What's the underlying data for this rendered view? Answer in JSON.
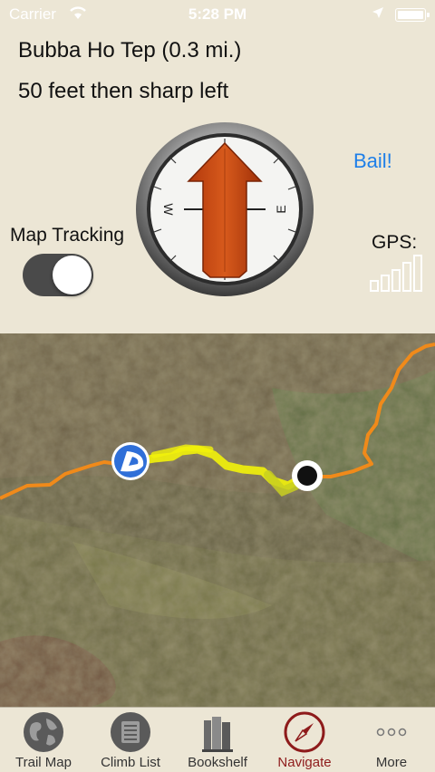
{
  "status_bar": {
    "carrier": "Carrier",
    "time": "5:28 PM"
  },
  "navigation": {
    "trail_name": "Bubba Ho Tep (0.3 mi.)",
    "instruction": "50 feet then sharp left",
    "bail_label": "Bail!",
    "map_tracking_label": "Map Tracking",
    "map_tracking_on": true,
    "gps_label": "GPS:",
    "gps_signal_bars": 5,
    "compass_letters": [
      "W",
      "E"
    ]
  },
  "tabs": [
    {
      "label": "Trail Map",
      "icon": "globe-icon",
      "active": false
    },
    {
      "label": "Climb List",
      "icon": "list-icon",
      "active": false
    },
    {
      "label": "Bookshelf",
      "icon": "books-icon",
      "active": false
    },
    {
      "label": "Navigate",
      "icon": "compass-icon",
      "active": true
    },
    {
      "label": "More",
      "icon": "more-icon",
      "active": false
    }
  ],
  "colors": {
    "background": "#ece6d5",
    "accent_link": "#1e7fe8",
    "active_tab": "#8e1b1b",
    "trail_orange": "#f08a1a",
    "route_yellow": "#f2f20a"
  }
}
